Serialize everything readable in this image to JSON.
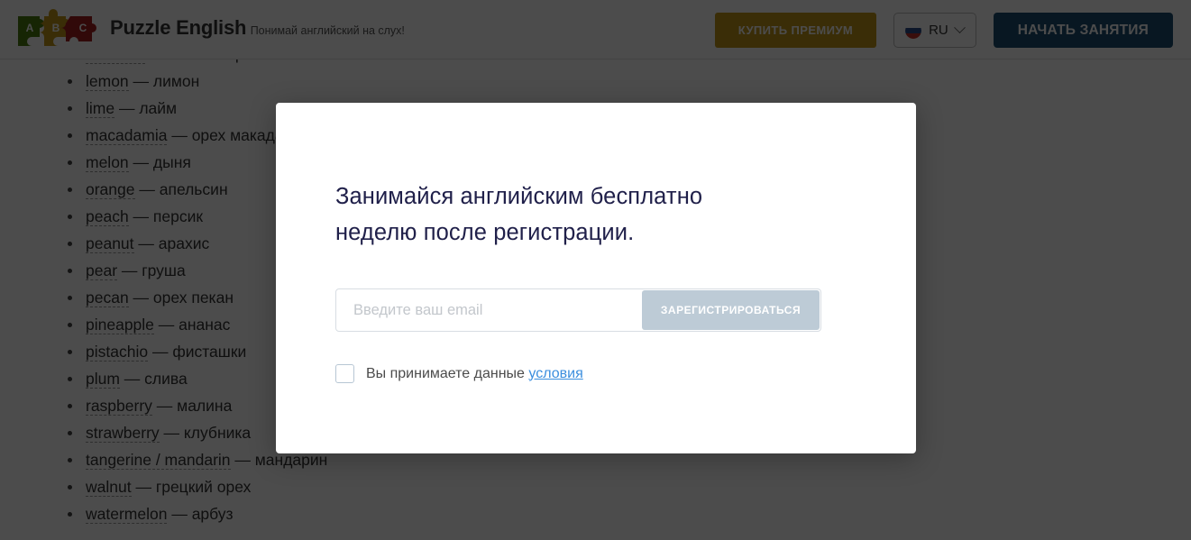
{
  "header": {
    "logo": {
      "icon": "puzzle-abc-logo",
      "pieces": [
        {
          "letter": "A",
          "color": "#4a7c0f"
        },
        {
          "letter": "B",
          "color": "#c2971a"
        },
        {
          "letter": "C",
          "color": "#a61f1f"
        }
      ]
    },
    "brand_title": "Puzzle English",
    "brand_tagline": "Понимай английский на слух!",
    "premium_button": "КУПИТЬ ПРЕМИУМ",
    "language": {
      "code": "RU",
      "flag_icon": "flag-ru-icon",
      "chevron_icon": "chevron-down-icon"
    },
    "start_button": "НАЧАТЬ ЗАНЯТИЯ",
    "colors": {
      "premium_bg": "#c2971a",
      "start_bg": "#1d4f72",
      "brand_title": "#333333"
    }
  },
  "content": {
    "words": [
      {
        "en": "hazelnut",
        "sep": "—",
        "ru": "лесной орех"
      },
      {
        "en": "lemon",
        "sep": "—",
        "ru": "лимон"
      },
      {
        "en": "lime",
        "sep": "—",
        "ru": "лайм"
      },
      {
        "en": "macadamia",
        "sep": "—",
        "ru": "орех макадамия"
      },
      {
        "en": "melon",
        "sep": "—",
        "ru": "дыня"
      },
      {
        "en": "orange",
        "sep": "—",
        "ru": "апельсин"
      },
      {
        "en": "peach",
        "sep": "—",
        "ru": "персик"
      },
      {
        "en": "peanut",
        "sep": "—",
        "ru": "арахис"
      },
      {
        "en": "pear",
        "sep": "—",
        "ru": "груша"
      },
      {
        "en": "pecan",
        "sep": "—",
        "ru": "орех пекан"
      },
      {
        "en": "pineapple",
        "sep": "—",
        "ru": "ананас"
      },
      {
        "en": "pistachio",
        "sep": "—",
        "ru": "фисташки"
      },
      {
        "en": "plum",
        "sep": "—",
        "ru": "слива"
      },
      {
        "en": "raspberry",
        "sep": "—",
        "ru": "малина"
      },
      {
        "en": "strawberry",
        "sep": "—",
        "ru": "клубника"
      },
      {
        "en": "tangerine / mandarin",
        "sep": "—",
        "ru": "мандарин"
      },
      {
        "en": "walnut",
        "sep": "—",
        "ru": "грецкий орех"
      },
      {
        "en": "watermelon",
        "sep": "—",
        "ru": "арбуз"
      }
    ]
  },
  "modal": {
    "title": "Занимайся английским бесплатно неделю после регистрации.",
    "email_placeholder": "Введите ваш email",
    "email_value": "",
    "signup_button": "ЗАРЕГИСТРИРОВАТЬСЯ",
    "terms_text": "Вы принимаете данные",
    "terms_link": "условия",
    "checkbox_checked": false,
    "colors": {
      "title": "#20204a",
      "signup_bg": "#bdcbd6",
      "link": "#3b8ede"
    }
  }
}
